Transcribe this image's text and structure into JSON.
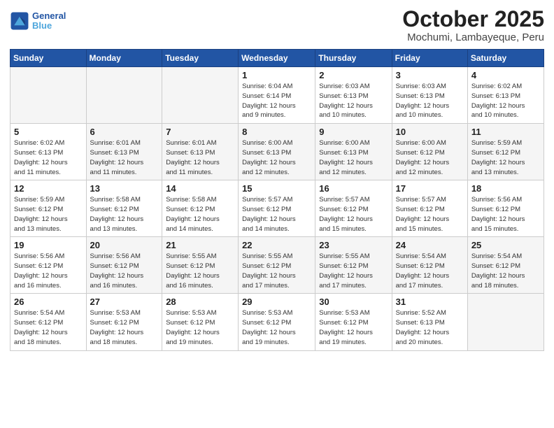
{
  "header": {
    "logo_line1": "General",
    "logo_line2": "Blue",
    "title": "October 2025",
    "subtitle": "Mochumi, Lambayeque, Peru"
  },
  "weekdays": [
    "Sunday",
    "Monday",
    "Tuesday",
    "Wednesday",
    "Thursday",
    "Friday",
    "Saturday"
  ],
  "weeks": [
    [
      {
        "day": "",
        "info": ""
      },
      {
        "day": "",
        "info": ""
      },
      {
        "day": "",
        "info": ""
      },
      {
        "day": "1",
        "info": "Sunrise: 6:04 AM\nSunset: 6:14 PM\nDaylight: 12 hours\nand 9 minutes."
      },
      {
        "day": "2",
        "info": "Sunrise: 6:03 AM\nSunset: 6:13 PM\nDaylight: 12 hours\nand 10 minutes."
      },
      {
        "day": "3",
        "info": "Sunrise: 6:03 AM\nSunset: 6:13 PM\nDaylight: 12 hours\nand 10 minutes."
      },
      {
        "day": "4",
        "info": "Sunrise: 6:02 AM\nSunset: 6:13 PM\nDaylight: 12 hours\nand 10 minutes."
      }
    ],
    [
      {
        "day": "5",
        "info": "Sunrise: 6:02 AM\nSunset: 6:13 PM\nDaylight: 12 hours\nand 11 minutes."
      },
      {
        "day": "6",
        "info": "Sunrise: 6:01 AM\nSunset: 6:13 PM\nDaylight: 12 hours\nand 11 minutes."
      },
      {
        "day": "7",
        "info": "Sunrise: 6:01 AM\nSunset: 6:13 PM\nDaylight: 12 hours\nand 11 minutes."
      },
      {
        "day": "8",
        "info": "Sunrise: 6:00 AM\nSunset: 6:13 PM\nDaylight: 12 hours\nand 12 minutes."
      },
      {
        "day": "9",
        "info": "Sunrise: 6:00 AM\nSunset: 6:13 PM\nDaylight: 12 hours\nand 12 minutes."
      },
      {
        "day": "10",
        "info": "Sunrise: 6:00 AM\nSunset: 6:12 PM\nDaylight: 12 hours\nand 12 minutes."
      },
      {
        "day": "11",
        "info": "Sunrise: 5:59 AM\nSunset: 6:12 PM\nDaylight: 12 hours\nand 13 minutes."
      }
    ],
    [
      {
        "day": "12",
        "info": "Sunrise: 5:59 AM\nSunset: 6:12 PM\nDaylight: 12 hours\nand 13 minutes."
      },
      {
        "day": "13",
        "info": "Sunrise: 5:58 AM\nSunset: 6:12 PM\nDaylight: 12 hours\nand 13 minutes."
      },
      {
        "day": "14",
        "info": "Sunrise: 5:58 AM\nSunset: 6:12 PM\nDaylight: 12 hours\nand 14 minutes."
      },
      {
        "day": "15",
        "info": "Sunrise: 5:57 AM\nSunset: 6:12 PM\nDaylight: 12 hours\nand 14 minutes."
      },
      {
        "day": "16",
        "info": "Sunrise: 5:57 AM\nSunset: 6:12 PM\nDaylight: 12 hours\nand 15 minutes."
      },
      {
        "day": "17",
        "info": "Sunrise: 5:57 AM\nSunset: 6:12 PM\nDaylight: 12 hours\nand 15 minutes."
      },
      {
        "day": "18",
        "info": "Sunrise: 5:56 AM\nSunset: 6:12 PM\nDaylight: 12 hours\nand 15 minutes."
      }
    ],
    [
      {
        "day": "19",
        "info": "Sunrise: 5:56 AM\nSunset: 6:12 PM\nDaylight: 12 hours\nand 16 minutes."
      },
      {
        "day": "20",
        "info": "Sunrise: 5:56 AM\nSunset: 6:12 PM\nDaylight: 12 hours\nand 16 minutes."
      },
      {
        "day": "21",
        "info": "Sunrise: 5:55 AM\nSunset: 6:12 PM\nDaylight: 12 hours\nand 16 minutes."
      },
      {
        "day": "22",
        "info": "Sunrise: 5:55 AM\nSunset: 6:12 PM\nDaylight: 12 hours\nand 17 minutes."
      },
      {
        "day": "23",
        "info": "Sunrise: 5:55 AM\nSunset: 6:12 PM\nDaylight: 12 hours\nand 17 minutes."
      },
      {
        "day": "24",
        "info": "Sunrise: 5:54 AM\nSunset: 6:12 PM\nDaylight: 12 hours\nand 17 minutes."
      },
      {
        "day": "25",
        "info": "Sunrise: 5:54 AM\nSunset: 6:12 PM\nDaylight: 12 hours\nand 18 minutes."
      }
    ],
    [
      {
        "day": "26",
        "info": "Sunrise: 5:54 AM\nSunset: 6:12 PM\nDaylight: 12 hours\nand 18 minutes."
      },
      {
        "day": "27",
        "info": "Sunrise: 5:53 AM\nSunset: 6:12 PM\nDaylight: 12 hours\nand 18 minutes."
      },
      {
        "day": "28",
        "info": "Sunrise: 5:53 AM\nSunset: 6:12 PM\nDaylight: 12 hours\nand 19 minutes."
      },
      {
        "day": "29",
        "info": "Sunrise: 5:53 AM\nSunset: 6:12 PM\nDaylight: 12 hours\nand 19 minutes."
      },
      {
        "day": "30",
        "info": "Sunrise: 5:53 AM\nSunset: 6:12 PM\nDaylight: 12 hours\nand 19 minutes."
      },
      {
        "day": "31",
        "info": "Sunrise: 5:52 AM\nSunset: 6:13 PM\nDaylight: 12 hours\nand 20 minutes."
      },
      {
        "day": "",
        "info": ""
      }
    ]
  ]
}
